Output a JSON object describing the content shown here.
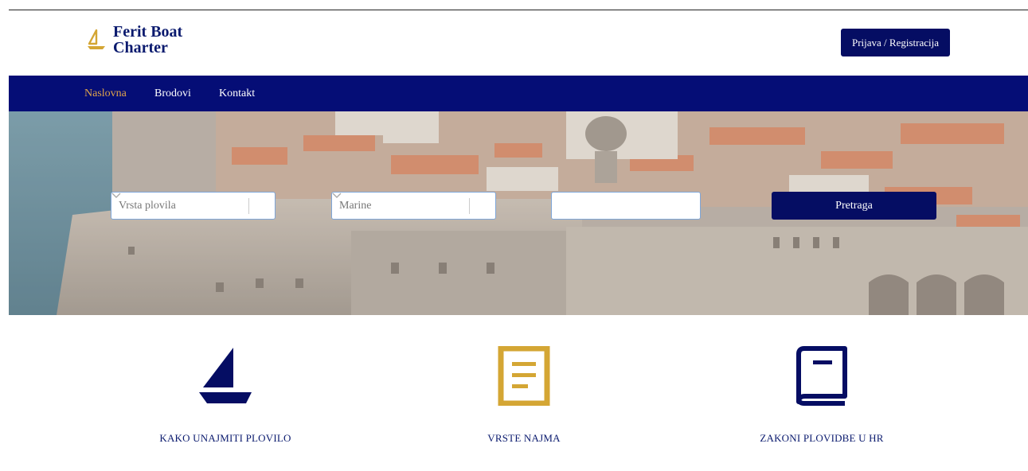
{
  "brand": {
    "line1": "Ferit Boat",
    "line2": "Charter",
    "logo_icon": "sailboat-icon",
    "color_primary": "#050d76",
    "color_accent": "#d4a634"
  },
  "header": {
    "login_label": "Prijava / Registracija"
  },
  "nav": {
    "items": [
      {
        "label": "Naslovna",
        "active": true
      },
      {
        "label": "Brodovi",
        "active": false
      },
      {
        "label": "Kontakt",
        "active": false
      }
    ]
  },
  "search": {
    "vessel_type": {
      "placeholder": "Vrsta plovila"
    },
    "marina": {
      "placeholder": "Marine"
    },
    "text_field": {
      "value": ""
    },
    "submit_label": "Pretraga"
  },
  "features": [
    {
      "label": "KAKO UNAJMITI PLOVILO",
      "icon": "sailboat-icon"
    },
    {
      "label": "VRSTE NAJMA",
      "icon": "document-icon"
    },
    {
      "label": "ZAKONI PLOVIDBE U HR",
      "icon": "book-icon"
    }
  ]
}
